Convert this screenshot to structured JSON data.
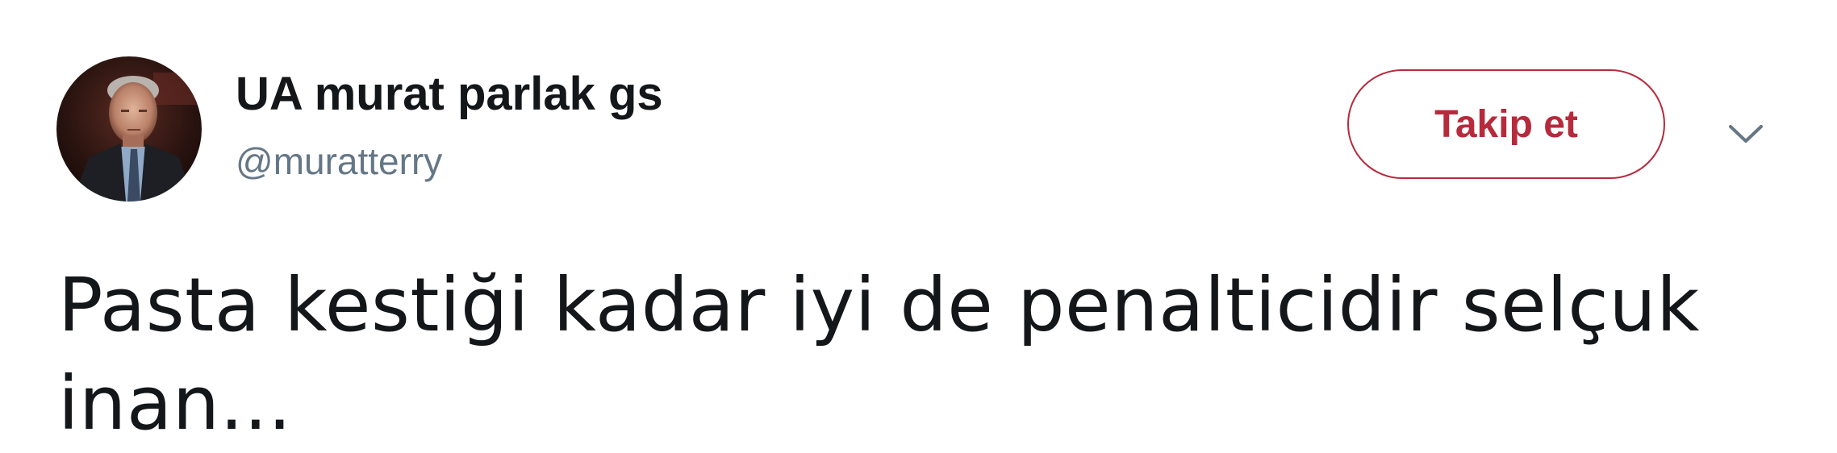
{
  "user": {
    "display_name": "UA murat parlak gs",
    "handle": "@muratterry",
    "avatar_icon": "profile-photo-man-in-suit"
  },
  "follow_button": {
    "label": "Takip et",
    "accent_color": "#b62a3c"
  },
  "menu": {
    "icon": "chevron-down-icon"
  },
  "tweet": {
    "text": "Pasta kestiği kadar iyi de penalticidir selçuk inan..."
  },
  "colors": {
    "text_primary": "#14171a",
    "text_secondary": "#657786",
    "background": "#ffffff"
  }
}
